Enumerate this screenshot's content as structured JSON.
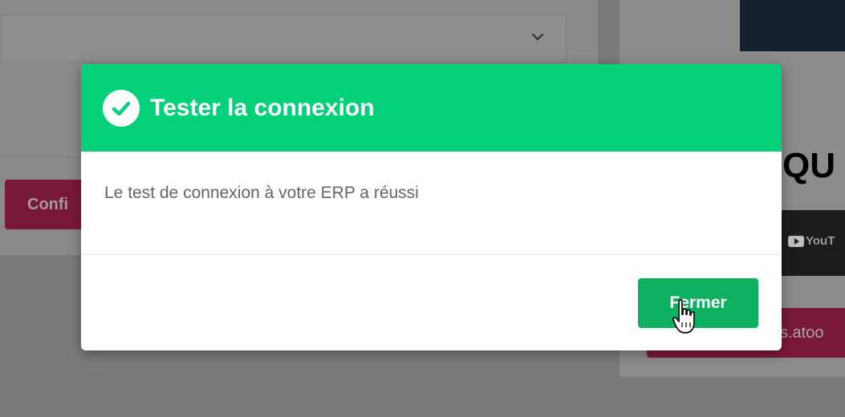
{
  "background": {
    "confirm_button_label": "Confi",
    "big_text": "QU",
    "video_label": "YouT",
    "link_button_label": "s.atoo"
  },
  "modal": {
    "title": "Tester la connexion",
    "message": "Le test de connexion à votre ERP a réussi",
    "close_button_label": "Fermer",
    "header_color": "#04d07a",
    "button_color": "#0db060"
  },
  "icons": {
    "header_icon": "check-circle-icon",
    "dropdown_icon": "chevron-down-icon",
    "cursor_icon": "hand-pointer-icon"
  }
}
